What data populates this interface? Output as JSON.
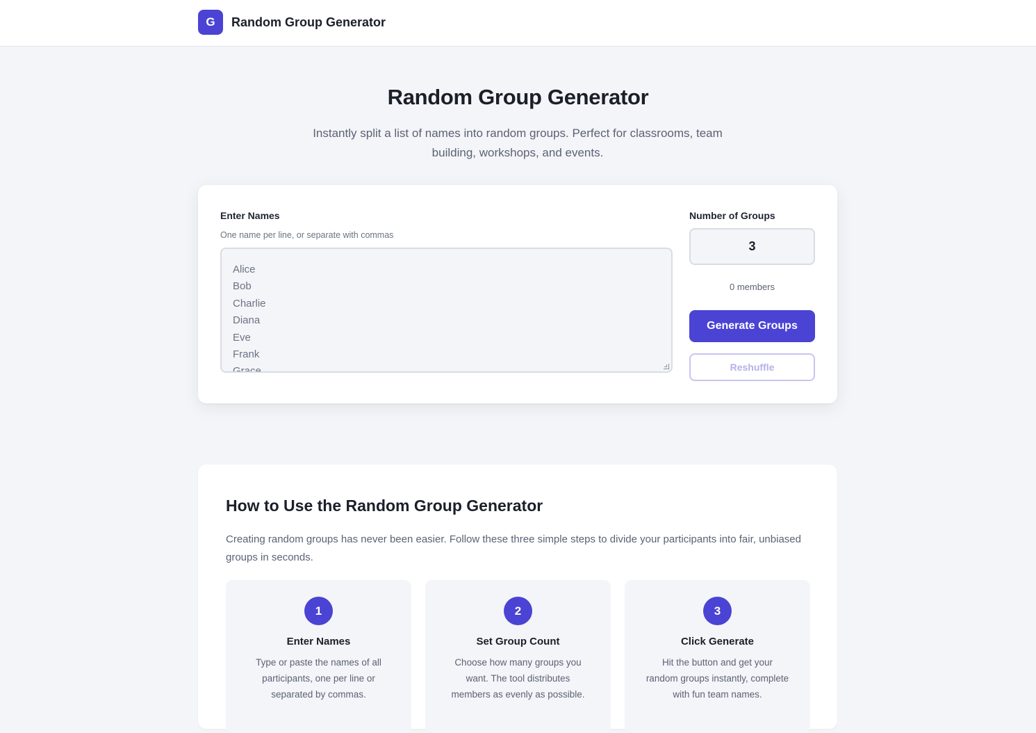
{
  "header": {
    "logo_letter": "G",
    "app_name": "Random Group Generator"
  },
  "hero": {
    "title": "Random Group Generator",
    "subtitle": "Instantly split a list of names into random groups. Perfect for classrooms, team building, workshops, and events."
  },
  "tool": {
    "names_label": "Enter Names",
    "names_hint": "One name per line, or separate with commas",
    "names": [
      "Alice",
      "Bob",
      "Charlie",
      "Diana",
      "Eve",
      "Frank",
      "Grace"
    ],
    "groups_label": "Number of Groups",
    "groups_value": "3",
    "members_text": "0 members",
    "generate_label": "Generate Groups",
    "reshuffle_label": "Reshuffle"
  },
  "howto": {
    "title": "How to Use the Random Group Generator",
    "intro": "Creating random groups has never been easier. Follow these three simple steps to divide your participants into fair, unbiased groups in seconds.",
    "steps": [
      {
        "num": "1",
        "title": "Enter Names",
        "text": "Type or paste the names of all participants, one per line or separated by commas."
      },
      {
        "num": "2",
        "title": "Set Group Count",
        "text": "Choose how many groups you want. The tool distributes members as evenly as possible."
      },
      {
        "num": "3",
        "title": "Click Generate",
        "text": "Hit the button and get your random groups instantly, complete with fun team names."
      }
    ]
  },
  "colors": {
    "accent": "#4a43d4",
    "background": "#f4f5f8",
    "text": "#1b1f2a",
    "muted": "#5a6275"
  }
}
